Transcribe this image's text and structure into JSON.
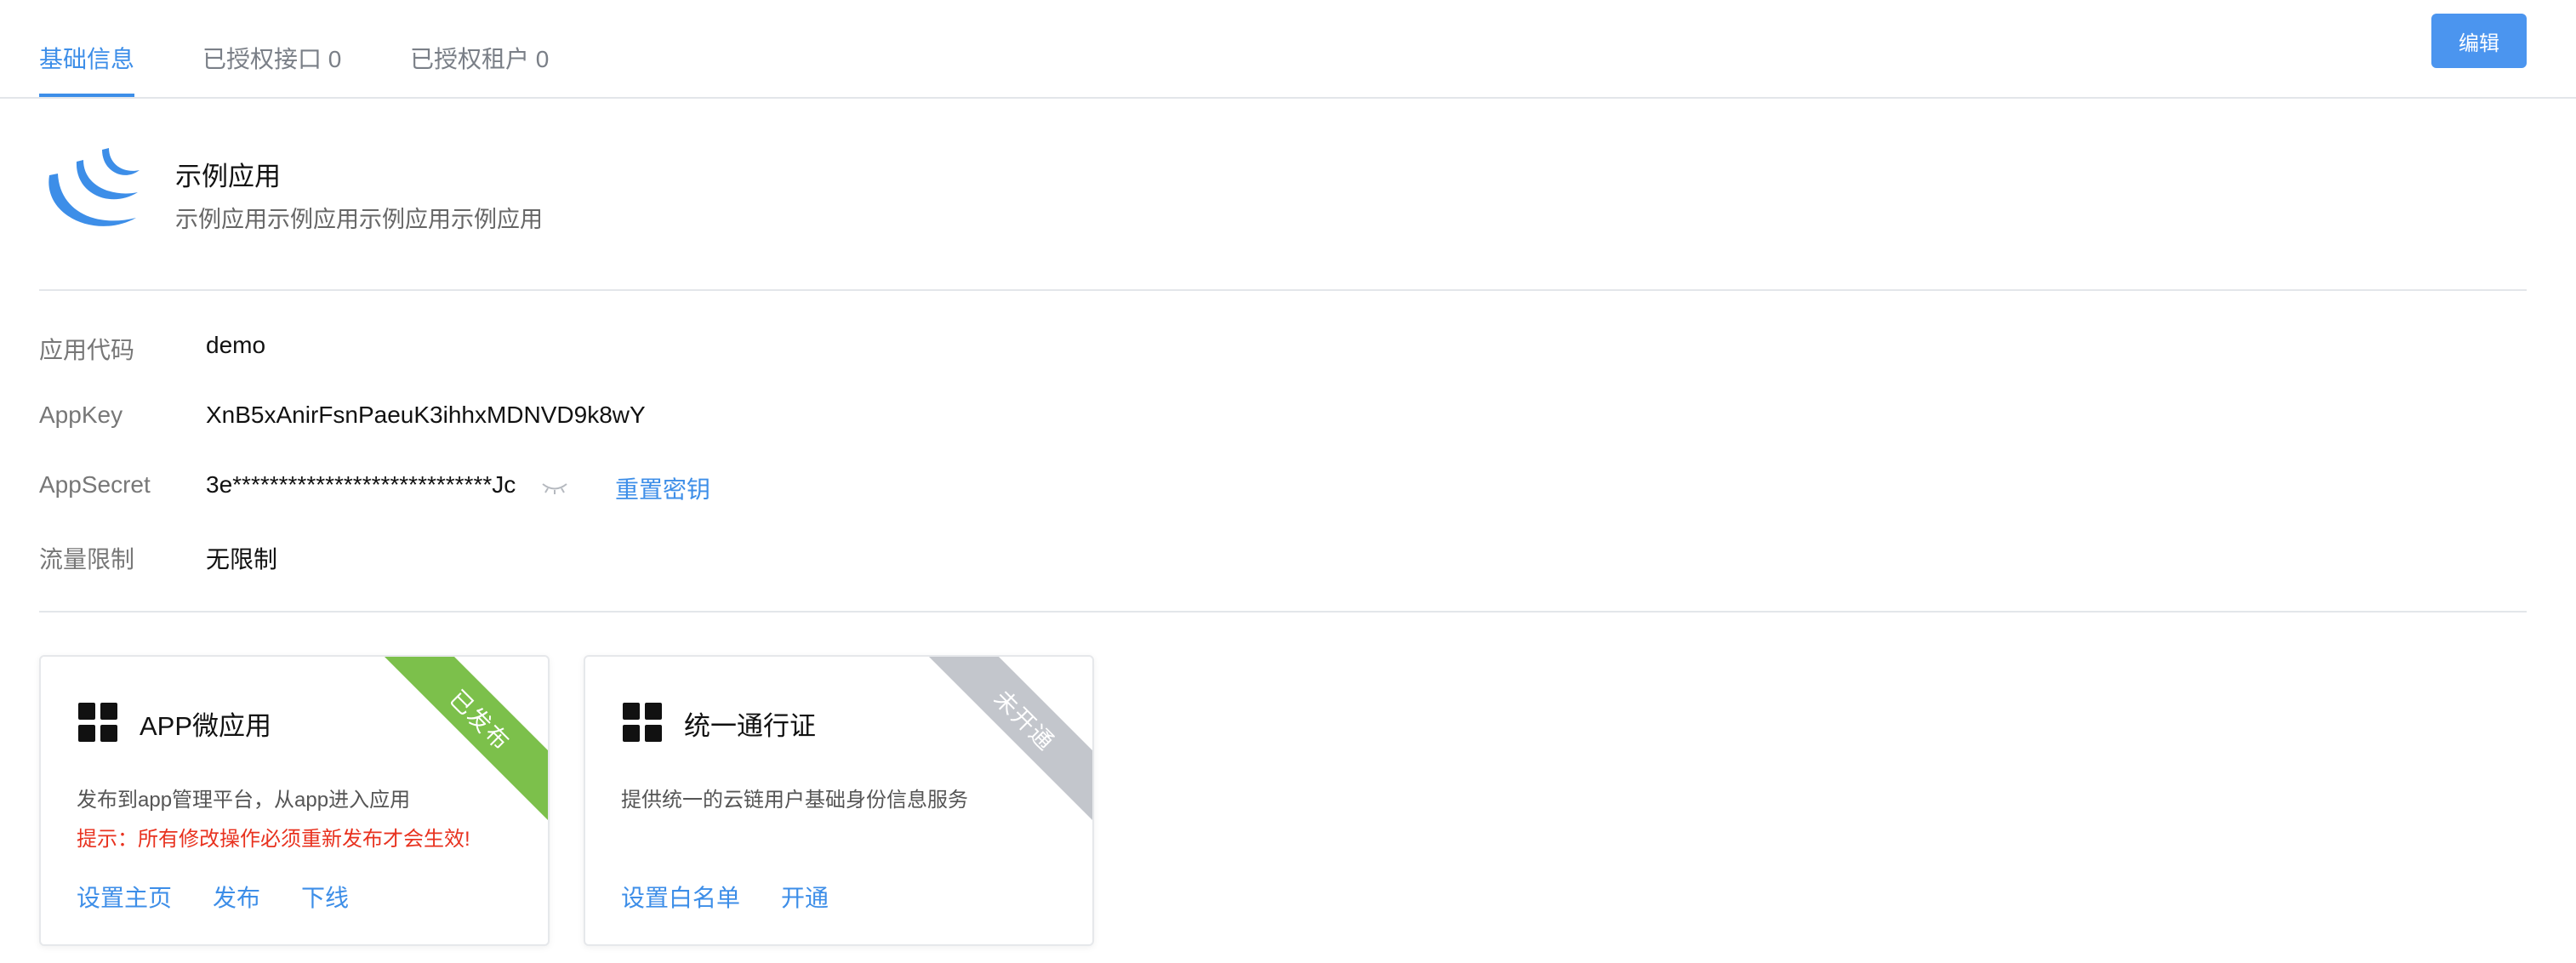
{
  "tabs": [
    {
      "label": "基础信息",
      "active": true
    },
    {
      "label": "已授权接口 0",
      "active": false
    },
    {
      "label": "已授权租户 0",
      "active": false
    }
  ],
  "header": {
    "edit_label": "编辑"
  },
  "app": {
    "logo_icon": "jquery-style-logo-icon",
    "name": "示例应用",
    "description": "示例应用示例应用示例应用示例应用"
  },
  "details": {
    "code_label": "应用代码",
    "code_value": "demo",
    "appkey_label": "AppKey",
    "appkey_value": "XnB5xAnirFsnPaeuK3ihhxMDNVD9k8wY",
    "appsecret_label": "AppSecret",
    "appsecret_value": "3e****************************Jc",
    "appsecret_toggle_icon": "eye-closed-icon",
    "reset_label": "重置密钥",
    "rate_label": "流量限制",
    "rate_value": "无限制"
  },
  "cards": [
    {
      "icon": "grid-apps-icon",
      "title": "APP微应用",
      "description": "发布到app管理平台，从app进入应用",
      "warning": "提示：所有修改操作必须重新发布才会生效!",
      "ribbon": "已发布",
      "ribbon_color": "#7cc04b",
      "actions": [
        "设置主页",
        "发布",
        "下线"
      ]
    },
    {
      "icon": "grid-apps-icon",
      "title": "统一通行证",
      "description": "提供统一的云链用户基础身份信息服务",
      "ribbon": "未开通",
      "ribbon_color": "#c3c6cc",
      "actions": [
        "设置白名单",
        "开通"
      ]
    }
  ],
  "colors": {
    "accent": "#3d8ee8",
    "warning": "#e8321f",
    "button": "#4b95ef"
  }
}
